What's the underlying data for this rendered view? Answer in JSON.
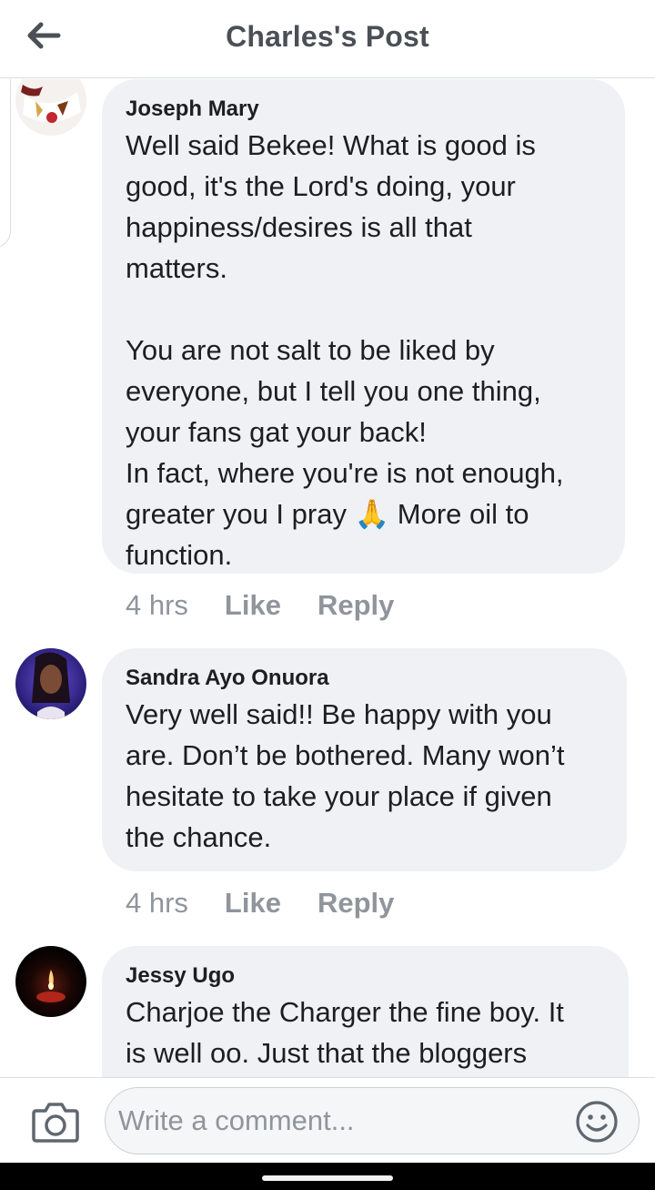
{
  "header": {
    "title": "Charles's Post",
    "back_icon": "arrow-left-icon"
  },
  "comments": [
    {
      "author": "Joseph Mary",
      "paragraphs": [
        [
          "Well said Bekee! What is good is",
          "good, it's the Lord's doing, your",
          "happiness/desires is all that",
          "matters."
        ],
        [
          "You are not salt to be liked by",
          "everyone, but I tell you one thing,",
          "your fans gat your back!",
          "In fact, where you're is not enough,",
          "greater you I pray 🙏 More oil to",
          "function."
        ]
      ],
      "time": "4 hrs",
      "like": "Like",
      "reply": "Reply"
    },
    {
      "author": "Sandra Ayo Onuora",
      "paragraphs": [
        [
          "Very well said!! Be happy with you",
          "are. Don’t be bothered. Many won’t",
          "hesitate to take your place if given",
          "the chance."
        ]
      ],
      "time": "4 hrs",
      "like": "Like",
      "reply": "Reply"
    },
    {
      "author": "Jessy Ugo",
      "paragraphs": [
        [
          "Charjoe the Charger the fine boy. It",
          "is well oo. Just that the bloggers"
        ]
      ]
    }
  ],
  "composer": {
    "placeholder": "Write a comment...",
    "camera_icon": "camera-icon",
    "emoji_icon": "smiley-icon"
  },
  "colors": {
    "bubble": "#f0f1f5",
    "meta_text": "#90949c",
    "header_text": "#4b4f56"
  }
}
